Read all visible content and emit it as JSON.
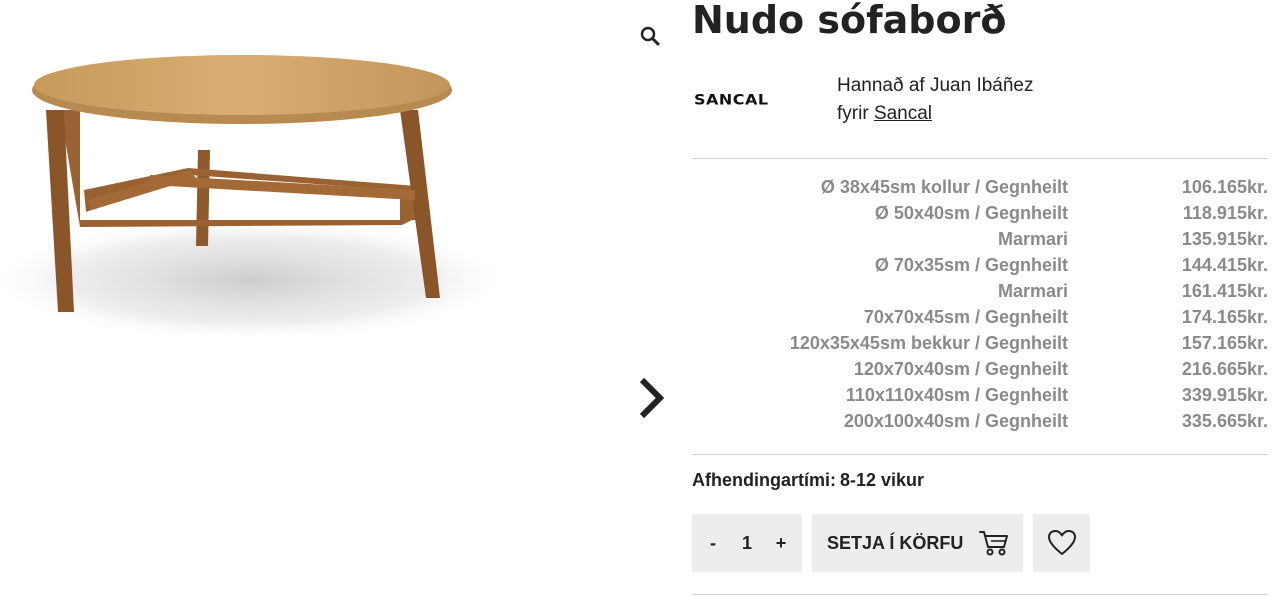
{
  "product": {
    "title": "Nudo sófaborð",
    "image_alt": "Nudo sófaborð",
    "brand_logo_text": "SANCAL",
    "designer_prefix": "Hannað af Juan Ibáñez",
    "brand_prefix": "fyrir",
    "brand_link": "Sancal"
  },
  "variants": [
    {
      "label": "Ø 38x45sm kollur / Gegnheilt",
      "price": "106.165kr."
    },
    {
      "label": "Ø 50x40sm / Gegnheilt",
      "price": "118.915kr."
    },
    {
      "label": "Marmari",
      "price": "135.915kr."
    },
    {
      "label": "Ø 70x35sm / Gegnheilt",
      "price": "144.415kr."
    },
    {
      "label": "Marmari",
      "price": "161.415kr."
    },
    {
      "label": "70x70x45sm / Gegnheilt",
      "price": "174.165kr."
    },
    {
      "label": "120x35x45sm bekkur / Gegnheilt",
      "price": "157.165kr."
    },
    {
      "label": "120x70x40sm / Gegnheilt",
      "price": "216.665kr."
    },
    {
      "label": "110x110x40sm / Gegnheilt",
      "price": "339.915kr."
    },
    {
      "label": "200x100x40sm / Gegnheilt",
      "price": "335.665kr."
    }
  ],
  "delivery": {
    "label": "Afhendingartími:",
    "value": "8-12 vikur"
  },
  "cart": {
    "minus": "-",
    "quantity": "1",
    "plus": "+",
    "add_to_cart_label": "SETJA Í KÖRFU"
  },
  "icons": {
    "zoom": "search-icon",
    "next": "chevron-right-icon",
    "cart": "cart-icon",
    "wishlist": "heart-icon"
  },
  "colors": {
    "button_bg": "#ededed",
    "muted_text": "#8a8a8a",
    "text": "#222222"
  }
}
